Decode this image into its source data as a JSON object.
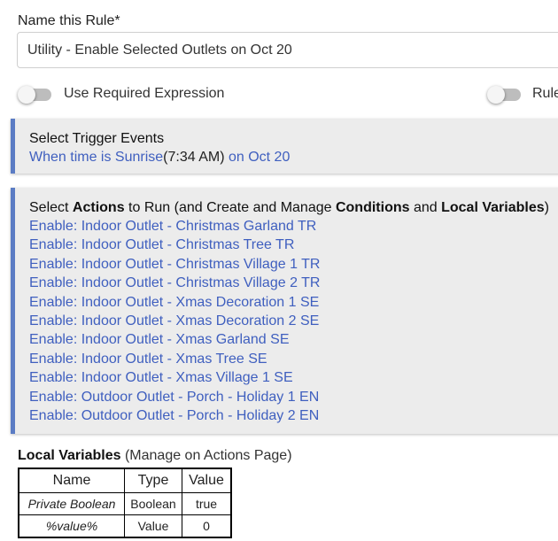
{
  "rule_name": {
    "label": "Name this Rule*",
    "value": "Utility - Enable Selected Outlets on Oct 20"
  },
  "toggles": {
    "required_expression": {
      "label": "Use Required Expression",
      "on": false
    },
    "rule_right": {
      "label": "Rule",
      "on": false
    }
  },
  "trigger_panel": {
    "title": "Select Trigger Events",
    "trigger_link": "When time is Sunrise",
    "trigger_time": "(7:34 AM)",
    "trigger_date_link": " on Oct 20"
  },
  "actions_panel": {
    "title_parts": {
      "p1": "Select ",
      "b1": "Actions",
      "p2": " to Run (and Create and Manage ",
      "b2": "Conditions",
      "p3": " and ",
      "b3": "Local Variables",
      "p4": ")"
    },
    "actions": [
      "Enable: Indoor Outlet - Christmas Garland TR",
      "Enable: Indoor Outlet - Christmas Tree TR",
      "Enable: Indoor Outlet - Christmas Village 1 TR",
      "Enable: Indoor Outlet - Christmas Village 2 TR",
      "Enable: Indoor Outlet - Xmas Decoration 1 SE",
      "Enable: Indoor Outlet - Xmas Decoration 2 SE",
      "Enable: Indoor Outlet - Xmas Garland SE",
      "Enable: Indoor Outlet - Xmas Tree SE",
      "Enable: Indoor Outlet - Xmas Village 1 SE",
      "Enable: Outdoor Outlet - Porch - Holiday 1 EN",
      "Enable: Outdoor Outlet - Porch - Holiday 2 EN"
    ]
  },
  "local_variables": {
    "title": "Local Variables",
    "subtitle": " (Manage on Actions Page)",
    "headers": [
      "Name",
      "Type",
      "Value"
    ],
    "rows": [
      [
        "Private Boolean",
        "Boolean",
        "true"
      ],
      [
        "%value%",
        "Value",
        "0"
      ]
    ]
  },
  "colors": {
    "link": "#3f5fbf",
    "panel_bg": "#ececec",
    "panel_accent": "#5b7cc4"
  }
}
